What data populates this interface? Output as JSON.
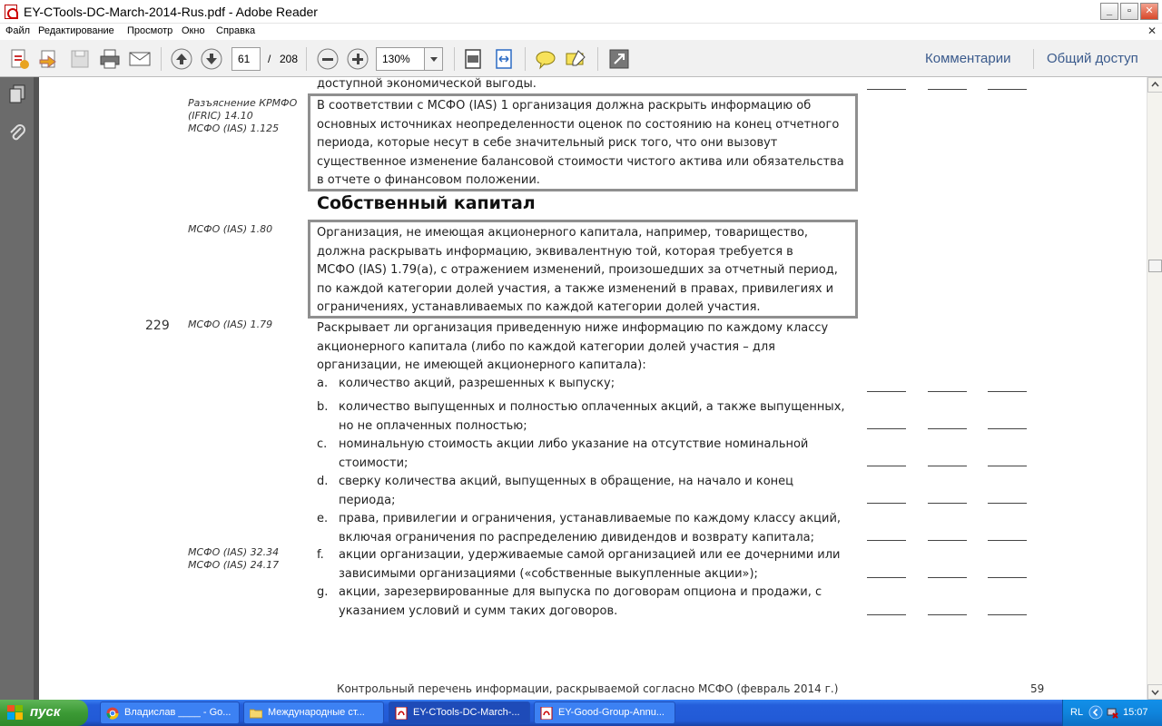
{
  "window": {
    "title": "EY-CTools-DC-March-2014-Rus.pdf - Adobe Reader"
  },
  "menu": [
    "Файл",
    "Редактирование",
    "Просмотр",
    "Окно",
    "Справка"
  ],
  "toolbar": {
    "page_current": "61",
    "page_separator": "/",
    "page_total": "208",
    "zoom": "130%",
    "comments_label": "Комментарии",
    "share_label": "Общий доступ"
  },
  "document": {
    "top_fragment": "доступной экономической выгоды.",
    "ref_ifric": [
      "Разъяснение КРМФО",
      "(IFRIC) 14.10",
      "МСФО (IAS) 1.125"
    ],
    "box1_lines": [
      "В соответствии с МСФО (IAS) 1 организация должна раскрыть информацию об",
      "основных источниках неопределенности оценок по состоянию на конец отчетного",
      "периода, которые несут в себе значительный риск того, что они вызовут",
      "существенное изменение балансовой стоимости чистого актива или обязательства",
      "в отчете о финансовом положении."
    ],
    "heading": "Собственный капитал",
    "ref_180": "МСФО (IAS) 1.80",
    "box2_lines": [
      "Организация, не имеющая акционерного капитала, например, товарищество,",
      "должна раскрывать информацию, эквивалентную той, которая требуется в",
      "МСФО (IAS) 1.79(a), с отражением изменений, произошедших за отчетный период,",
      "по каждой категории долей участия, а также изменений в правах, привилегиях и",
      "ограничениях, устанавливаемых по каждой категории долей участия."
    ],
    "item_number": "229",
    "ref_179": "МСФО (IAS) 1.79",
    "question_lines": [
      "Раскрывает ли организация приведенную ниже информацию по каждому классу",
      "акционерного капитала (либо по каждой категории долей участия – для",
      "организации, не имеющей акционерного капитала):"
    ],
    "ref_3234": [
      "МСФО (IAS) 32.34",
      "МСФО (IAS) 24.17"
    ],
    "items": [
      {
        "letter": "a.",
        "lines": [
          "количество акций, разрешенных к выпуску;"
        ]
      },
      {
        "letter": "b.",
        "lines": [
          "количество выпущенных и полностью оплаченных акций, а также выпущенных,",
          "но не оплаченных полностью;"
        ]
      },
      {
        "letter": "c.",
        "lines": [
          "номинальную стоимость акции либо указание на отсутствие номинальной",
          "стоимости;"
        ]
      },
      {
        "letter": "d.",
        "lines": [
          "сверку количества акций, выпущенных в обращение, на начало и конец",
          "периода;"
        ]
      },
      {
        "letter": "e.",
        "lines": [
          "права, привилегии и ограничения, устанавливаемые по каждому классу акций,",
          "включая ограничения по распределению дивидендов и возврату капитала;"
        ]
      },
      {
        "letter": "f.",
        "lines": [
          "акции организации, удерживаемые самой организацией или ее дочерними или",
          "зависимыми организациями («собственные выкупленные акции»);"
        ]
      },
      {
        "letter": "g.",
        "lines": [
          "акции, зарезервированные для выпуска по договорам опциона и продажи, с",
          "указанием условий и сумм таких договоров."
        ]
      }
    ],
    "footer": "Контрольный перечень информации, раскрываемой согласно МСФО (февраль 2014 г.)",
    "footer_page": "59"
  },
  "taskbar": {
    "start": "пуск",
    "tasks": [
      {
        "label": "Владислав ____ - Go..."
      },
      {
        "label": "Международные ст..."
      },
      {
        "label": "EY-CTools-DC-March-..."
      },
      {
        "label": "EY-Good-Group-Annu..."
      }
    ],
    "lang": "RL",
    "clock": "15:07"
  }
}
